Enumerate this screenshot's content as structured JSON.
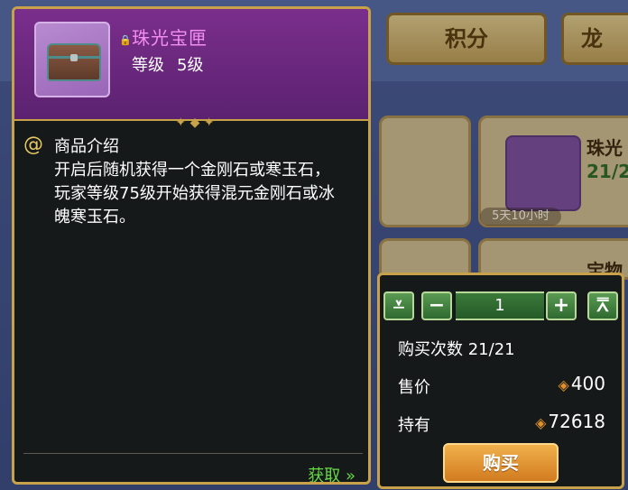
{
  "background": {
    "tab_score": "积分",
    "tab_other": "龙",
    "card_title": "珠光",
    "card_count": "21/2",
    "card_timer": "5天10小时",
    "card2_title": "宝物"
  },
  "item": {
    "name": "珠光宝匣",
    "level_label": "等级",
    "level_value": "5级",
    "icon": "treasure-chest-icon"
  },
  "description": {
    "title": "商品介绍",
    "text": "开启后随机获得一个金刚石或寒玉石，玩家等级75级开始获得混元金刚石或冰魄寒玉石。"
  },
  "obtain": {
    "label": "获取 »"
  },
  "purchase": {
    "quantity": "1",
    "buy_times_label": "购买次数",
    "buy_times_value": "21/21",
    "price_label": "售价",
    "price_value": "400",
    "own_label": "持有",
    "own_value": "72618",
    "buy_button": "购买",
    "min_icon": "double-down-icon",
    "max_icon": "double-up-icon",
    "dec_label": "−",
    "inc_label": "+"
  },
  "colors": {
    "panel_border": "#c8a24a",
    "item_name": "#f28ef0",
    "obtain": "#66d845",
    "buy_button": "#d27b20"
  }
}
